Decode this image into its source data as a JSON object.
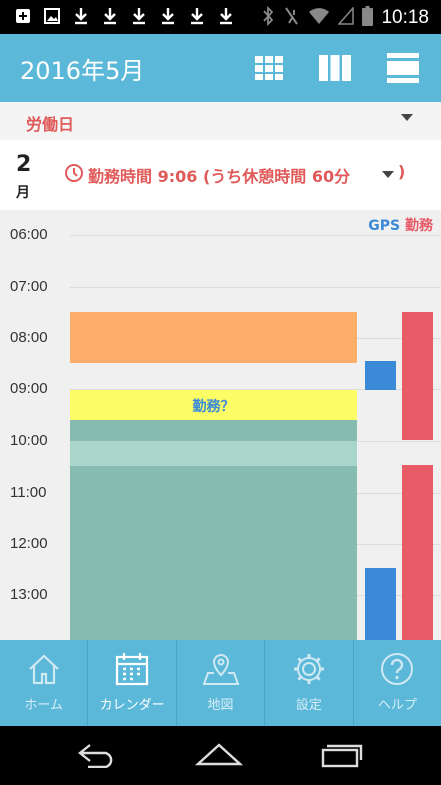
{
  "status_bar": {
    "time": "10:18",
    "icons": [
      "add-box-icon",
      "image-icon",
      "download-icon",
      "download-icon",
      "download-icon",
      "download-icon",
      "download-icon",
      "download-icon"
    ],
    "right_icons": [
      "bluetooth-icon",
      "mute-icon",
      "wifi-icon",
      "signal-icon",
      "battery-icon"
    ]
  },
  "header": {
    "title": "2016年5月",
    "view_buttons": [
      "month-grid-view",
      "week-columns-view",
      "day-list-view"
    ]
  },
  "day_type": {
    "label": "労働日"
  },
  "summary": {
    "day": "2",
    "unit": "月",
    "text": "勤務時間 9:06 (うち休憩時間 60分",
    "paren_close": ")"
  },
  "timeline": {
    "legend_gps": "GPS",
    "legend_work": "勤務",
    "hours": [
      "06:00",
      "07:00",
      "08:00",
      "09:00",
      "10:00",
      "11:00",
      "12:00",
      "13:00"
    ],
    "suggest_label": "勤務？",
    "colors": {
      "orange": "#fcae6a",
      "yellow": "#fdfd66",
      "teal": "#87bcb0",
      "teal_light": "#a9d5cb",
      "gps_blue": "#3b8ad8",
      "work_red": "#e85a65"
    }
  },
  "tabs": [
    {
      "label": "ホーム",
      "icon": "home-icon",
      "active": false
    },
    {
      "label": "カレンダー",
      "icon": "calendar-icon",
      "active": true
    },
    {
      "label": "地図",
      "icon": "map-pin-icon",
      "active": false
    },
    {
      "label": "設定",
      "icon": "gear-icon",
      "active": false
    },
    {
      "label": "ヘルプ",
      "icon": "help-icon",
      "active": false
    }
  ]
}
